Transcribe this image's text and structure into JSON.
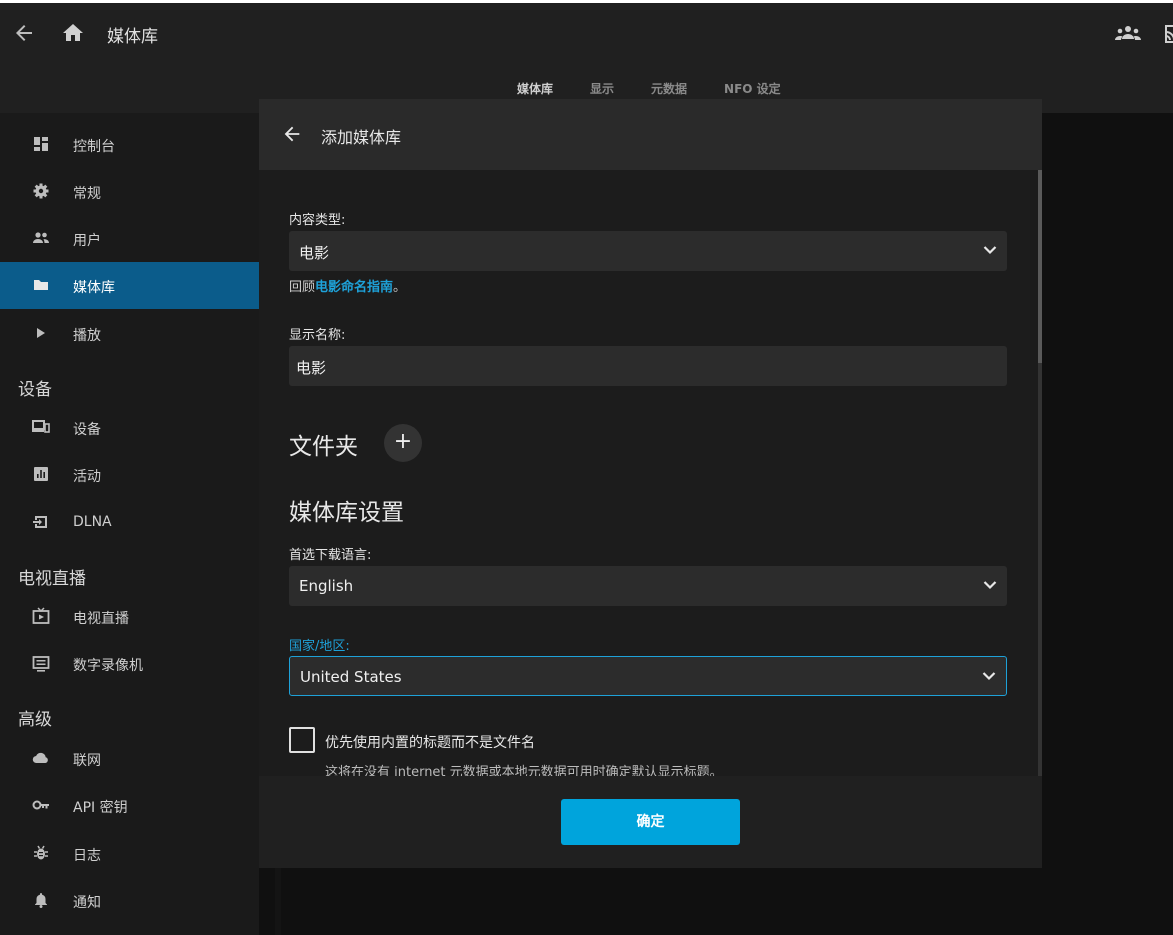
{
  "header": {
    "title": "媒体库",
    "tabs": [
      "媒体库",
      "显示",
      "元数据",
      "NFO 设定"
    ],
    "active_tab": 0
  },
  "sidebar": {
    "items_top": [
      {
        "label": "控制台",
        "icon": "dashboard-icon"
      },
      {
        "label": "常规",
        "icon": "gear-icon"
      },
      {
        "label": "用户",
        "icon": "users-icon"
      },
      {
        "label": "媒体库",
        "icon": "folder-icon",
        "active": true
      },
      {
        "label": "播放",
        "icon": "play-icon"
      }
    ],
    "section_devices": "设备",
    "items_devices": [
      {
        "label": "设备",
        "icon": "devices-icon"
      },
      {
        "label": "活动",
        "icon": "activity-icon"
      },
      {
        "label": "DLNA",
        "icon": "input-icon"
      }
    ],
    "section_livetv": "电视直播",
    "items_livetv": [
      {
        "label": "电视直播",
        "icon": "live-tv-icon"
      },
      {
        "label": "数字录像机",
        "icon": "dvr-icon"
      }
    ],
    "section_advanced": "高级",
    "items_advanced": [
      {
        "label": "联网",
        "icon": "cloud-icon"
      },
      {
        "label": "API 密钥",
        "icon": "key-icon"
      },
      {
        "label": "日志",
        "icon": "bug-icon"
      },
      {
        "label": "通知",
        "icon": "bell-icon"
      }
    ]
  },
  "dialog": {
    "title": "添加媒体库",
    "content_type_label": "内容类型:",
    "content_type_value": "电影",
    "hint_prefix": "回顾",
    "hint_link": "电影命名指南",
    "hint_suffix": "。",
    "display_name_label": "显示名称:",
    "display_name_value": "电影",
    "folders_heading": "文件夹",
    "add_folder_symbol": "+",
    "library_settings_heading": "媒体库设置",
    "language_label": "首选下载语言:",
    "language_value": "English",
    "country_label": "国家/地区:",
    "country_value": "United States",
    "checkbox_label": "优先使用内置的标题而不是文件名",
    "checkbox_checked": false,
    "checkbox_desc": "这将在没有 internet 元数据或本地元数据可用时确定默认显示标题。",
    "ok_label": "确定"
  },
  "colors": {
    "accent": "#00a4dc",
    "active_nav": "#0b5c8b",
    "link": "#1ea1d8"
  }
}
